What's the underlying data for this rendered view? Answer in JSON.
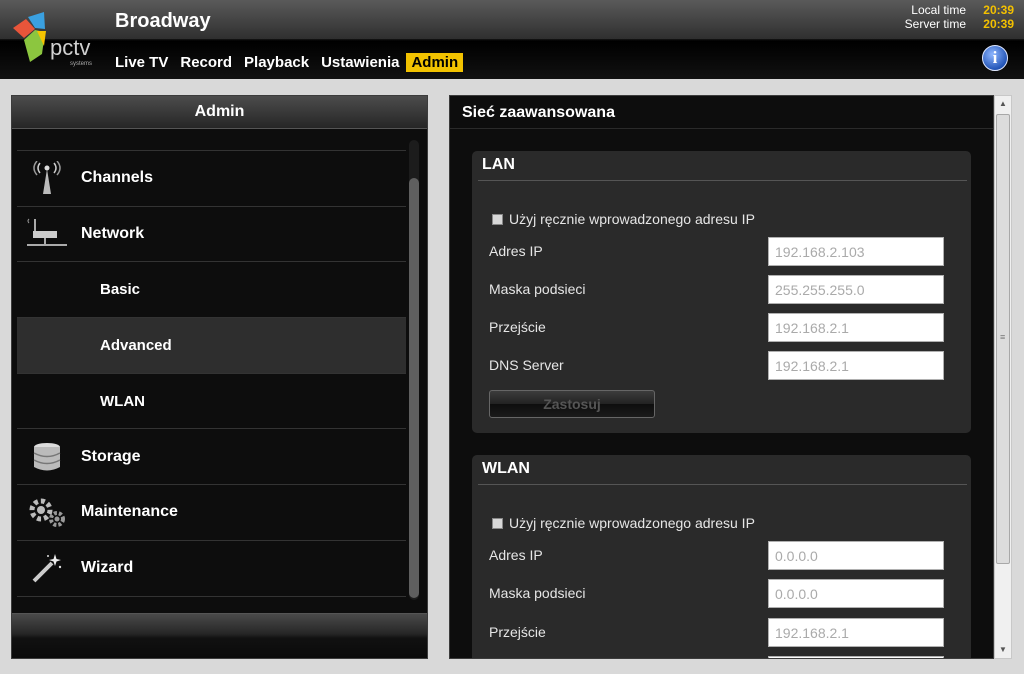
{
  "header": {
    "app_title": "Broadway",
    "logo_text": "pctv",
    "logo_sub": "systems",
    "local_time_label": "Local time",
    "local_time": "20:39",
    "server_time_label": "Server time",
    "server_time": "20:39",
    "nav": [
      "Live TV",
      "Record",
      "Playback",
      "Ustawienia",
      "Admin"
    ],
    "active_nav": "Admin",
    "accent_color": "#f2c200"
  },
  "left": {
    "title": "Admin",
    "items": [
      {
        "label": "Channels",
        "icon": "antenna-icon"
      },
      {
        "label": "Network",
        "icon": "router-icon"
      },
      {
        "label": "Basic",
        "icon": null
      },
      {
        "label": "Advanced",
        "icon": null
      },
      {
        "label": "WLAN",
        "icon": null
      },
      {
        "label": "Storage",
        "icon": "database-icon"
      },
      {
        "label": "Maintenance",
        "icon": "gears-icon"
      },
      {
        "label": "Wizard",
        "icon": "magic-wand-icon"
      }
    ],
    "selected": "Advanced"
  },
  "right": {
    "title": "Sieć zaawansowana",
    "lan": {
      "title": "LAN",
      "manual_label": "Użyj ręcznie wprowadzonego adresu IP",
      "ip_label": "Adres IP",
      "ip_value": "192.168.2.103",
      "mask_label": "Maska podsieci",
      "mask_value": "255.255.255.0",
      "gateway_label": "Przejście",
      "gateway_value": "192.168.2.1",
      "dns_label": "DNS Server",
      "dns_value": "192.168.2.1",
      "apply_label": "Zastosuj"
    },
    "wlan": {
      "title": "WLAN",
      "manual_label": "Użyj ręcznie wprowadzonego adresu IP",
      "ip_label": "Adres IP",
      "ip_value": "0.0.0.0",
      "mask_label": "Maska podsieci",
      "mask_value": "0.0.0.0",
      "gateway_label": "Przejście",
      "gateway_value": "192.168.2.1"
    }
  }
}
